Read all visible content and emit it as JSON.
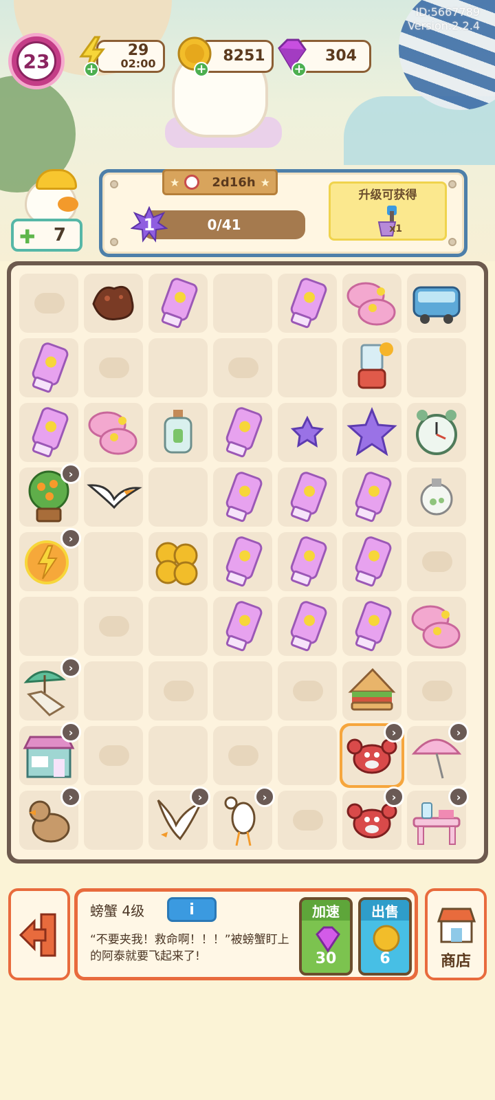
{
  "meta": {
    "id_text": "ID:5667789",
    "version_text": "Version:2.2.4"
  },
  "hud": {
    "level": "23",
    "energy": "29",
    "energy_timer": "02:00",
    "coins": "8251",
    "gems": "304",
    "plus_symbol": "+"
  },
  "worker": {
    "star_count": "7"
  },
  "task": {
    "timer": "2d16h",
    "level": "1",
    "progress": "0/41",
    "reward_title": "升级可获得",
    "reward_qty": "x1"
  },
  "board": {
    "cols": 7,
    "rows": 9,
    "items": [
      {
        "r": 0,
        "c": 1,
        "kind": "mud"
      },
      {
        "r": 0,
        "c": 2,
        "kind": "sunscreen"
      },
      {
        "r": 0,
        "c": 4,
        "kind": "sunscreen"
      },
      {
        "r": 0,
        "c": 5,
        "kind": "slippers"
      },
      {
        "r": 0,
        "c": 6,
        "kind": "bus"
      },
      {
        "r": 1,
        "c": 0,
        "kind": "sunscreen"
      },
      {
        "r": 1,
        "c": 5,
        "kind": "blender"
      },
      {
        "r": 2,
        "c": 0,
        "kind": "sunscreen"
      },
      {
        "r": 2,
        "c": 1,
        "kind": "slippers"
      },
      {
        "r": 2,
        "c": 2,
        "kind": "bottle"
      },
      {
        "r": 2,
        "c": 3,
        "kind": "sunscreen"
      },
      {
        "r": 2,
        "c": 4,
        "kind": "star-small"
      },
      {
        "r": 2,
        "c": 5,
        "kind": "star-big"
      },
      {
        "r": 2,
        "c": 6,
        "kind": "clock"
      },
      {
        "r": 3,
        "c": 0,
        "kind": "orange-tree",
        "badge": true
      },
      {
        "r": 3,
        "c": 1,
        "kind": "seagull-fly"
      },
      {
        "r": 3,
        "c": 3,
        "kind": "sunscreen"
      },
      {
        "r": 3,
        "c": 4,
        "kind": "sunscreen"
      },
      {
        "r": 3,
        "c": 5,
        "kind": "sunscreen"
      },
      {
        "r": 3,
        "c": 6,
        "kind": "bulb"
      },
      {
        "r": 4,
        "c": 0,
        "kind": "energy",
        "badge": true
      },
      {
        "r": 4,
        "c": 2,
        "kind": "coins"
      },
      {
        "r": 4,
        "c": 3,
        "kind": "sunscreen"
      },
      {
        "r": 4,
        "c": 4,
        "kind": "sunscreen"
      },
      {
        "r": 4,
        "c": 5,
        "kind": "sunscreen"
      },
      {
        "r": 5,
        "c": 3,
        "kind": "sunscreen"
      },
      {
        "r": 5,
        "c": 4,
        "kind": "sunscreen"
      },
      {
        "r": 5,
        "c": 5,
        "kind": "sunscreen"
      },
      {
        "r": 5,
        "c": 6,
        "kind": "slippers"
      },
      {
        "r": 6,
        "c": 0,
        "kind": "beach-chair",
        "badge": true
      },
      {
        "r": 6,
        "c": 5,
        "kind": "sandwich"
      },
      {
        "r": 7,
        "c": 0,
        "kind": "shop",
        "badge": true
      },
      {
        "r": 7,
        "c": 5,
        "kind": "crab",
        "badge": true,
        "selected": true
      },
      {
        "r": 7,
        "c": 6,
        "kind": "parasol",
        "badge": true
      },
      {
        "r": 8,
        "c": 0,
        "kind": "duckling",
        "badge": true
      },
      {
        "r": 8,
        "c": 2,
        "kind": "seagull",
        "badge": true
      },
      {
        "r": 8,
        "c": 3,
        "kind": "stork",
        "badge": true
      },
      {
        "r": 8,
        "c": 5,
        "kind": "crab",
        "badge": true
      },
      {
        "r": 8,
        "c": 6,
        "kind": "table",
        "badge": true
      }
    ],
    "badge_symbol": "›"
  },
  "info": {
    "name": "螃蟹 4级",
    "info_icon": "i",
    "desc": "“不要夹我！救命啊！！！”被螃蟹盯上的阿泰就要飞起来了!",
    "speed_label": "加速",
    "speed_cost": "30",
    "sell_label": "出售",
    "sell_price": "6"
  },
  "shop": {
    "label": "商店"
  },
  "colors": {
    "accent": "#e86b3d",
    "board": "#6d5a4e",
    "panel_blue": "#4d7fa9"
  }
}
